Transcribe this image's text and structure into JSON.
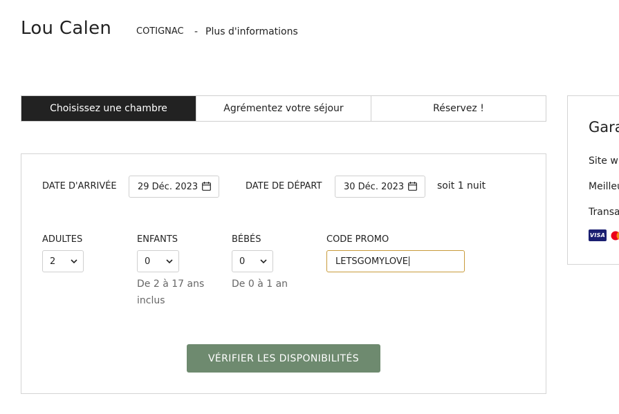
{
  "header": {
    "hotel_name": "Lou Calen",
    "city": "COTIGNAC",
    "separator": "-",
    "more_info": "Plus d'informations"
  },
  "tabs": [
    {
      "label": "Choisissez une chambre",
      "active": true
    },
    {
      "label": "Agrémentez votre séjour",
      "active": false
    },
    {
      "label": "Réservez !",
      "active": false
    }
  ],
  "search": {
    "arrival_label": "DATE D'ARRIVÉE",
    "arrival_value": "29 Déc. 2023",
    "departure_label": "DATE DE DÉPART",
    "departure_value": "30 Déc. 2023",
    "nights_text": "soit 1 nuit",
    "adults_label": "ADULTES",
    "adults_value": "2",
    "children_label": "ENFANTS",
    "children_value": "0",
    "children_hint": "De 2 à 17 ans inclus",
    "babies_label": "BÉBÉS",
    "babies_value": "0",
    "babies_hint": "De 0 à 1 an",
    "promo_label": "CODE PROMO",
    "promo_value": "LETSGOMYLOVE",
    "verify_button": "VÉRIFIER LES DISPONIBILITÉS"
  },
  "sidebar": {
    "title": "Gara",
    "items": [
      "Site w",
      "Meilleu",
      "Transa"
    ],
    "payment_icons": [
      "visa-card-icon",
      "mastercard-icon"
    ],
    "visa_text": "VISA"
  },
  "colors": {
    "active_tab_bg": "#222222",
    "verify_button_bg": "#6e8a6f",
    "promo_border": "#c89a3a",
    "visa_blue": "#1a1f71"
  }
}
